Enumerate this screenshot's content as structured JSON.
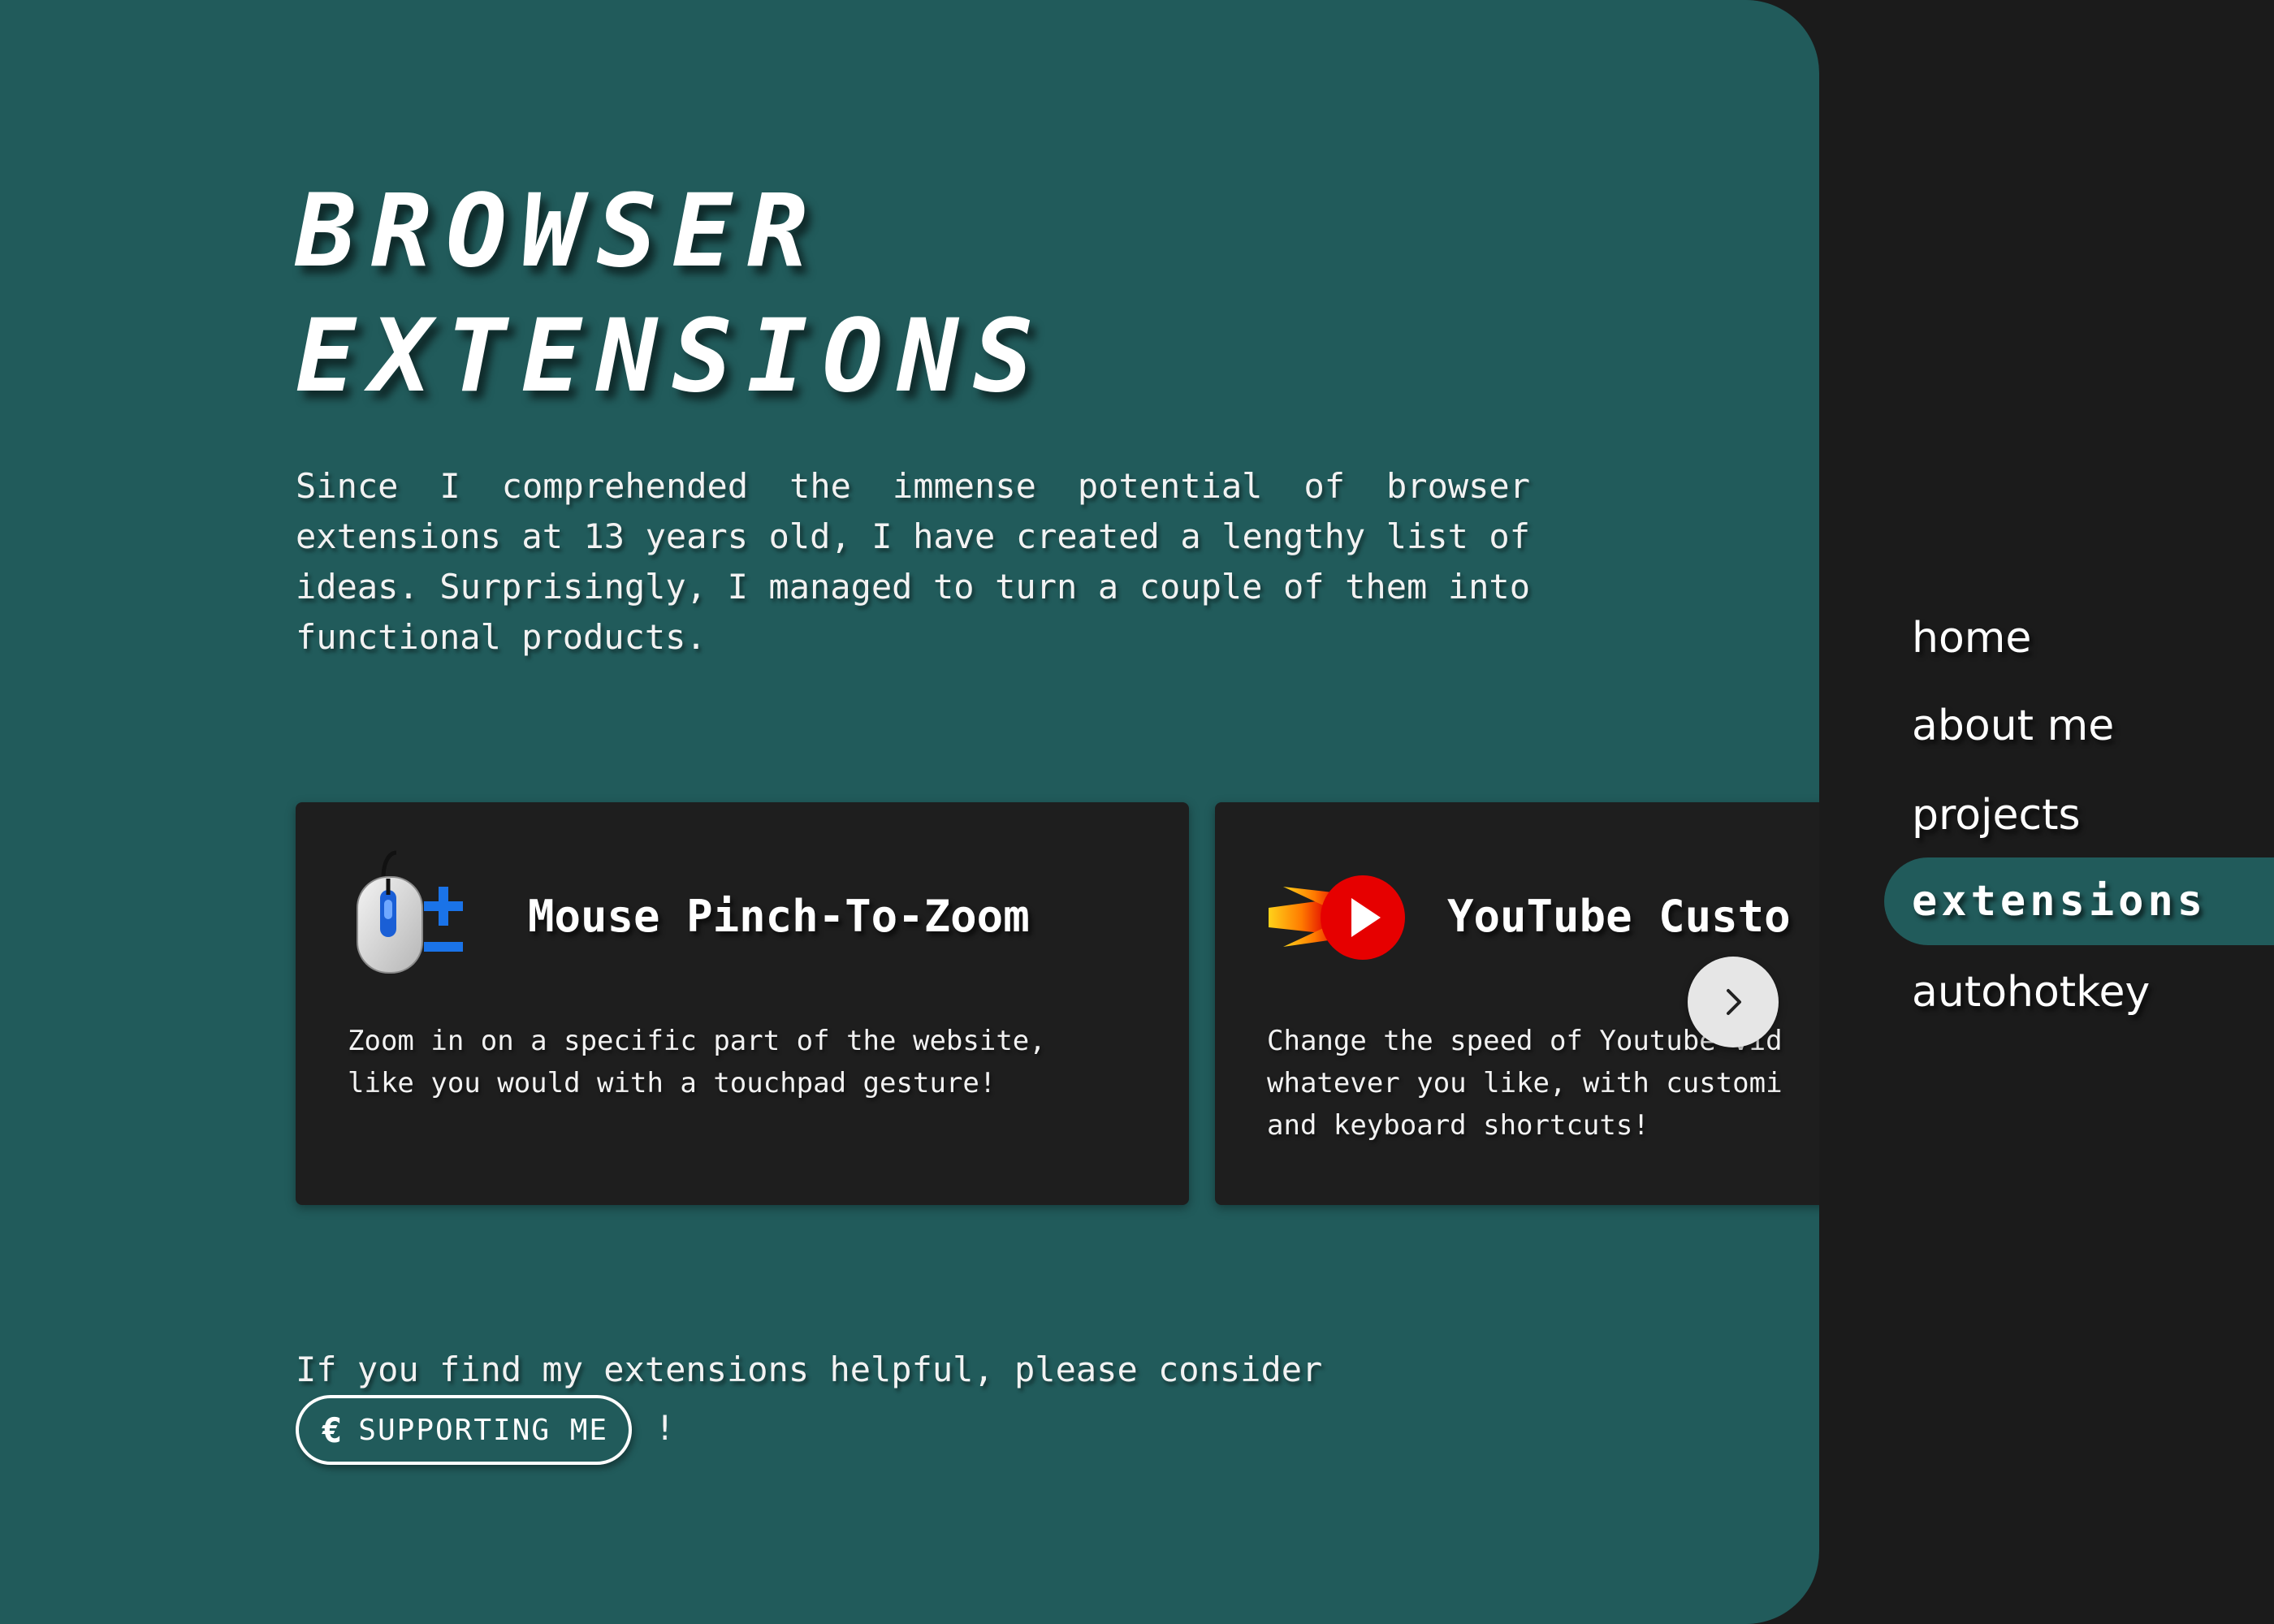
{
  "header": {
    "title_line1": "BROWSER",
    "title_line2": "EXTENSIONS"
  },
  "intro": "Since I comprehended the immense potential of browser extensions at 13 years old, I have created a lengthy list of ideas. Surprisingly, I managed to turn a couple of them into functional products.",
  "extensions": [
    {
      "title": "Mouse Pinch-To-Zoom",
      "description": "Zoom in on a specific part of the website,\nlike you would with a touchpad gesture!",
      "icon": "mouse-zoom-icon"
    },
    {
      "title": "YouTube Custo",
      "description": "Change the speed of Youtube vid\nwhatever you like, with customi\nand keyboard shortcuts!",
      "icon": "youtube-speed-icon"
    }
  ],
  "carousel": {
    "next_icon": "chevron-right-icon"
  },
  "support": {
    "text": "If you find my extensions helpful, please consider",
    "button_label": "SUPPORTING ME",
    "button_icon": "euro-icon",
    "suffix": "!"
  },
  "nav": {
    "items": [
      {
        "label": "home",
        "active": false
      },
      {
        "label": "about me",
        "active": false
      },
      {
        "label": "projects",
        "active": false
      },
      {
        "label": "extensions",
        "active": true
      },
      {
        "label": "autohotkey",
        "active": false
      }
    ]
  },
  "colors": {
    "main_bg": "#215b5b",
    "sidebar_bg": "#1b1b1b",
    "card_bg": "#1e1e1e",
    "accent_blue": "#1a73e8"
  }
}
